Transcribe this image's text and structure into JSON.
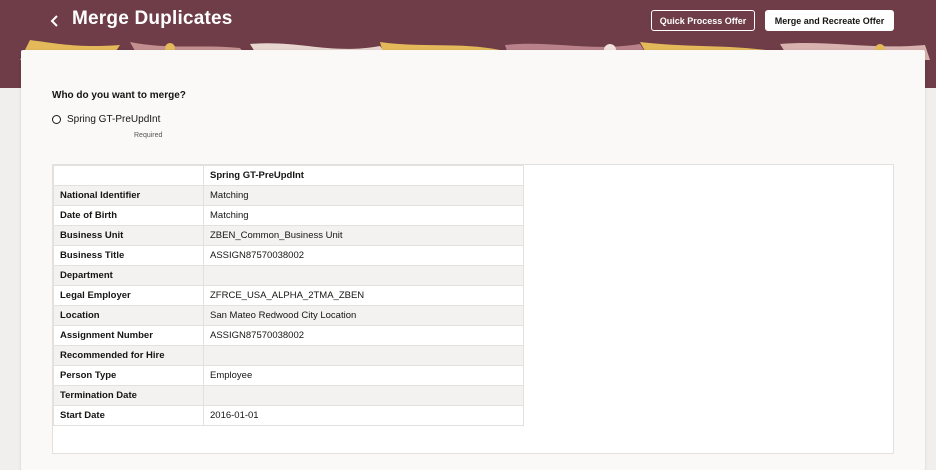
{
  "header": {
    "title": "Merge Duplicates",
    "quick_process_label": "Quick Process Offer",
    "merge_recreate_label": "Merge and Recreate Offer"
  },
  "question": "Who do you want to merge?",
  "option": {
    "label": "Spring GT-PreUpdInt",
    "helper": "Required"
  },
  "table": {
    "column_header": "Spring GT-PreUpdInt",
    "rows": [
      {
        "label": "National Identifier",
        "value": "Matching"
      },
      {
        "label": "Date of Birth",
        "value": "Matching"
      },
      {
        "label": "Business Unit",
        "value": "ZBEN_Common_Business Unit"
      },
      {
        "label": "Business Title",
        "value": "ASSIGN87570038002"
      },
      {
        "label": "Department",
        "value": ""
      },
      {
        "label": "Legal Employer",
        "value": "ZFRCE_USA_ALPHA_2TMA_ZBEN"
      },
      {
        "label": "Location",
        "value": "San Mateo Redwood City Location"
      },
      {
        "label": "Assignment Number",
        "value": "ASSIGN87570038002"
      },
      {
        "label": "Recommended for Hire",
        "value": ""
      },
      {
        "label": "Person Type",
        "value": "Employee"
      },
      {
        "label": "Termination Date",
        "value": ""
      },
      {
        "label": "Start Date",
        "value": "2016-01-01"
      }
    ]
  },
  "colors": {
    "header_bg": "#6e3d48",
    "accent_yellow": "#e3b95a",
    "accent_pink": "#c48f8f"
  }
}
